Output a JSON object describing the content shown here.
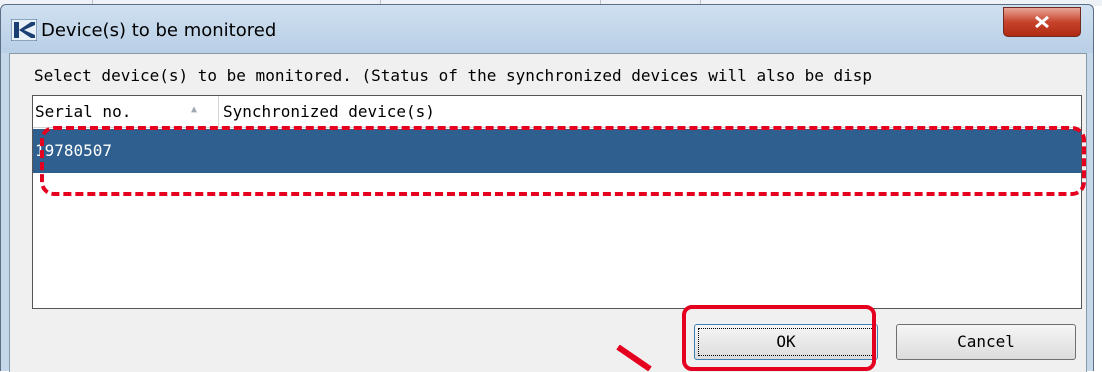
{
  "window": {
    "title": "Device(s) to be monitored"
  },
  "dialog": {
    "instruction": "Select device(s) to be monitored. (Status of the synchronized devices will also be disp"
  },
  "list": {
    "columns": [
      {
        "label": "Serial no.",
        "sorted": "ascending"
      },
      {
        "label": "Synchronized device(s)"
      }
    ],
    "rows": [
      {
        "serial": "19780507",
        "synchronized": "",
        "selected": true
      }
    ]
  },
  "buttons": {
    "ok": "OK",
    "cancel": "Cancel"
  },
  "icons": {
    "app": "k-logo-icon",
    "close": "close-x-icon",
    "sort": "sort-ascending-icon"
  },
  "colors": {
    "selection": "#2f5f8f",
    "annotation": "#e4001e",
    "titlebar": "#c5d8ea",
    "close": "#c7432b"
  }
}
